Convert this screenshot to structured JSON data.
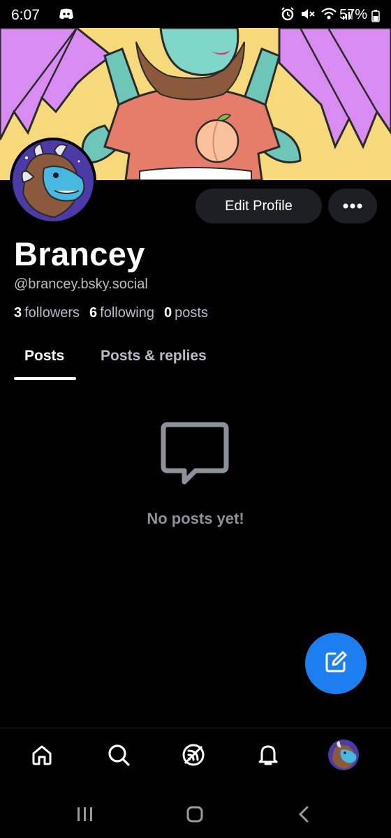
{
  "status_bar": {
    "time": "6:07",
    "battery": "57%",
    "icons": [
      "discord-icon",
      "alarm-icon",
      "mute-icon",
      "wifi-icon",
      "signal-icon",
      "battery-icon"
    ]
  },
  "profile": {
    "display_name": "Brancey",
    "handle": "@brancey.bsky.social",
    "followers_count": "3",
    "followers_label": "followers",
    "following_count": "6",
    "following_label": "following",
    "posts_count": "0",
    "posts_label": "posts"
  },
  "actions": {
    "edit_profile_label": "Edit Profile",
    "more_icon": "ellipsis-icon"
  },
  "tabs": [
    {
      "label": "Posts",
      "active": true
    },
    {
      "label": "Posts & replies",
      "active": false
    }
  ],
  "empty_state": {
    "icon": "message-bubble-icon",
    "text": "No posts yet!"
  },
  "fab": {
    "icon": "compose-icon",
    "color": "#1d7ef0"
  },
  "bottom_nav": [
    "home-icon",
    "search-icon",
    "feeds-icon",
    "notifications-icon",
    "profile-avatar"
  ],
  "colors": {
    "background": "#000000",
    "button_bg": "#1e1f24",
    "muted_text": "#b8bcc4",
    "accent": "#1d7ef0"
  }
}
